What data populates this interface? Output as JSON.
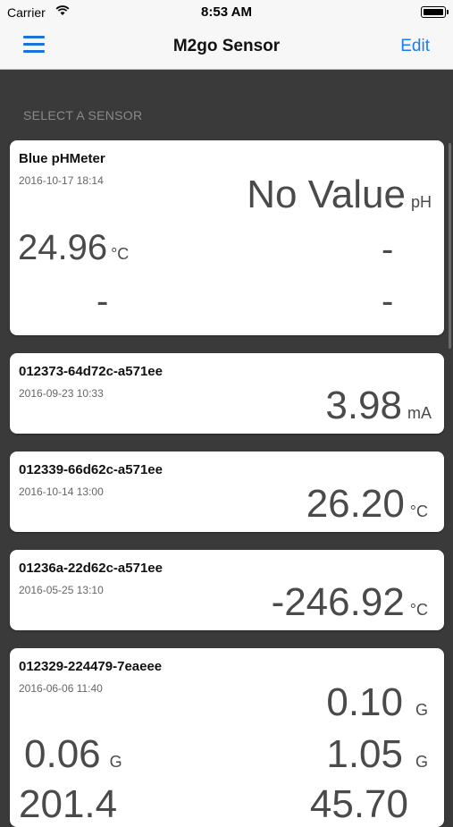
{
  "status_bar": {
    "carrier": "Carrier",
    "time": "8:53 AM"
  },
  "nav": {
    "title": "M2go Sensor",
    "edit_label": "Edit",
    "menu_icon": "hamburger-menu-icon"
  },
  "section_header": "SELECT A SENSOR",
  "colors": {
    "accent": "#1a7ef2",
    "background": "#3a3a3a",
    "card": "#ffffff"
  },
  "sensors": [
    {
      "name": "Blue pHMeter",
      "date": "2016-10-17 18:14",
      "primary": {
        "value": "No Value",
        "unit": "pH"
      },
      "secondary": {
        "value": "24.96",
        "unit": "°C"
      },
      "dash": "-"
    },
    {
      "name": "012373-64d72c-a571ee",
      "date": "2016-09-23 10:33",
      "primary": {
        "value": "3.98",
        "unit": "mA"
      }
    },
    {
      "name": "012339-66d62c-a571ee",
      "date": "2016-10-14 13:00",
      "primary": {
        "value": "26.20",
        "unit": "°C"
      }
    },
    {
      "name": "01236a-22d62c-a571ee",
      "date": "2016-05-25 13:10",
      "primary": {
        "value": "-246.92",
        "unit": "°C"
      }
    },
    {
      "name": "012329-224479-7eaeee",
      "date": "2016-06-06 11:40",
      "primary": {
        "value": "0.10",
        "unit": "G"
      },
      "secondary_left": {
        "value": "0.06",
        "unit": "G"
      },
      "secondary_right": {
        "value": "1.05",
        "unit": "G"
      },
      "partial_left": "201.4",
      "partial_right": "45.70"
    }
  ]
}
